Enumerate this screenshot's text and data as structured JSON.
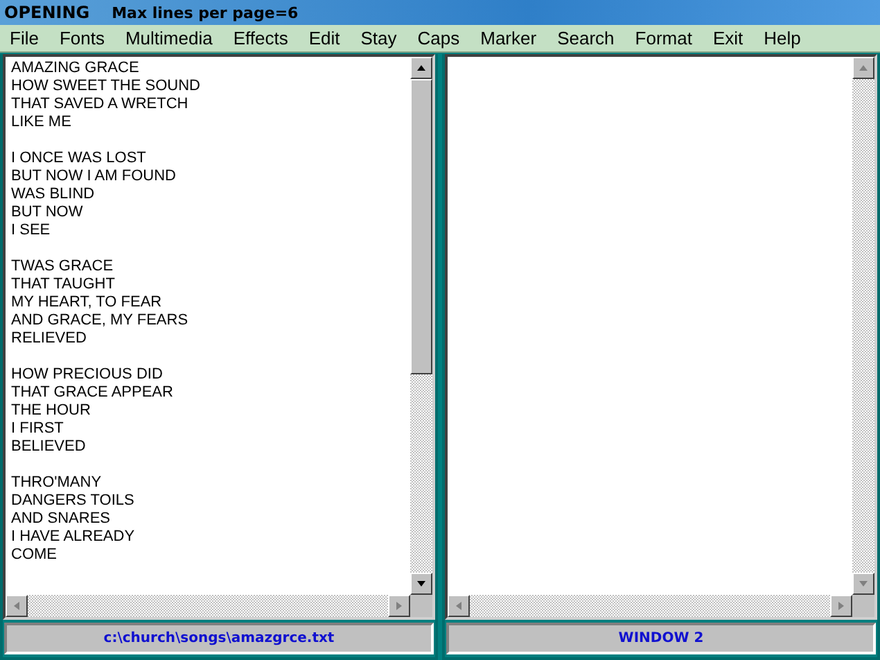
{
  "title_bar": {
    "title": "OPENING",
    "info": "Max lines per page=6"
  },
  "menu": [
    "File",
    "Fonts",
    "Multimedia",
    "Effects",
    "Edit",
    "Stay",
    "Caps",
    "Marker",
    "Search",
    "Format",
    "Exit",
    "Help"
  ],
  "panes": [
    {
      "stanzas": [
        {
          "lines": [
            "AMAZING GRACE",
            "HOW SWEET THE SOUND",
            "THAT SAVED A WRETCH",
            "LIKE ME"
          ]
        },
        {
          "lines": [
            "I ONCE WAS LOST",
            "BUT NOW I AM FOUND",
            "WAS BLIND",
            "BUT NOW",
            "I SEE"
          ]
        },
        {
          "lines": [
            "TWAS GRACE",
            "THAT TAUGHT",
            "MY HEART, TO FEAR",
            "AND GRACE, MY FEARS",
            "RELIEVED"
          ]
        },
        {
          "lines": [
            "HOW PRECIOUS DID",
            "THAT GRACE APPEAR",
            "THE HOUR",
            "I FIRST",
            "BELIEVED"
          ]
        },
        {
          "lines": [
            "THRO'MANY",
            "DANGERS TOILS",
            "AND SNARES",
            "I HAVE ALREADY",
            "COME"
          ]
        }
      ],
      "scroll_enabled": true,
      "status": "c:\\church\\songs\\amazgrce.txt"
    },
    {
      "scroll_enabled": false,
      "status": "WINDOW 2"
    }
  ]
}
